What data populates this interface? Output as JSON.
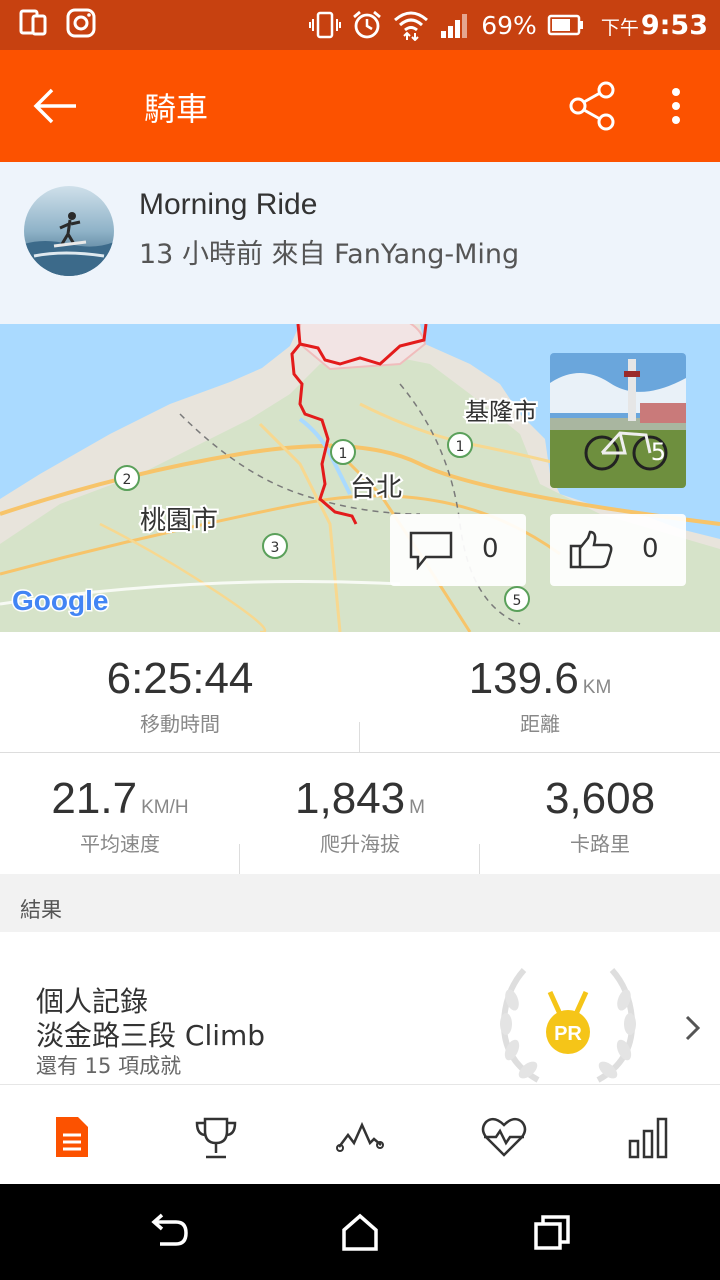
{
  "status_bar": {
    "battery": "69%",
    "time_prefix": "下午",
    "time": "9:53"
  },
  "app_bar": {
    "title": "騎車"
  },
  "activity": {
    "title": "Morning Ride",
    "subtitle": "13 小時前 來自 FanYang-Ming"
  },
  "map": {
    "labels": {
      "keelung": "基隆市",
      "taipei": "台北",
      "taoyuan": "桃園市",
      "google": "Google"
    },
    "route_markers": [
      "1",
      "1",
      "2",
      "3",
      "5"
    ],
    "photo_count": "5",
    "comment_count": "0",
    "kudos_count": "0"
  },
  "stats": {
    "moving_time": {
      "value": "6:25:44",
      "unit": "",
      "label": "移動時間"
    },
    "distance": {
      "value": "139.6",
      "unit": "KM",
      "label": "距離"
    },
    "avg_speed": {
      "value": "21.7",
      "unit": "KM/H",
      "label": "平均速度"
    },
    "elevation": {
      "value": "1,843",
      "unit": "M",
      "label": "爬升海拔"
    },
    "calories": {
      "value": "3,608",
      "unit": "",
      "label": "卡路里"
    }
  },
  "results": {
    "header": "結果",
    "line1": "個人記錄",
    "line2": "淡金路三段 Climb",
    "line3": "還有 15 項成就",
    "badge_text": "PR"
  },
  "tabs": [
    "overview-icon",
    "trophy-icon",
    "elevation-icon",
    "heart-rate-icon",
    "analysis-icon"
  ],
  "colors": {
    "brand": "#fc5200",
    "status_bar": "#c74110",
    "route": "#e31b1b",
    "pr_gold": "#f5c518"
  }
}
